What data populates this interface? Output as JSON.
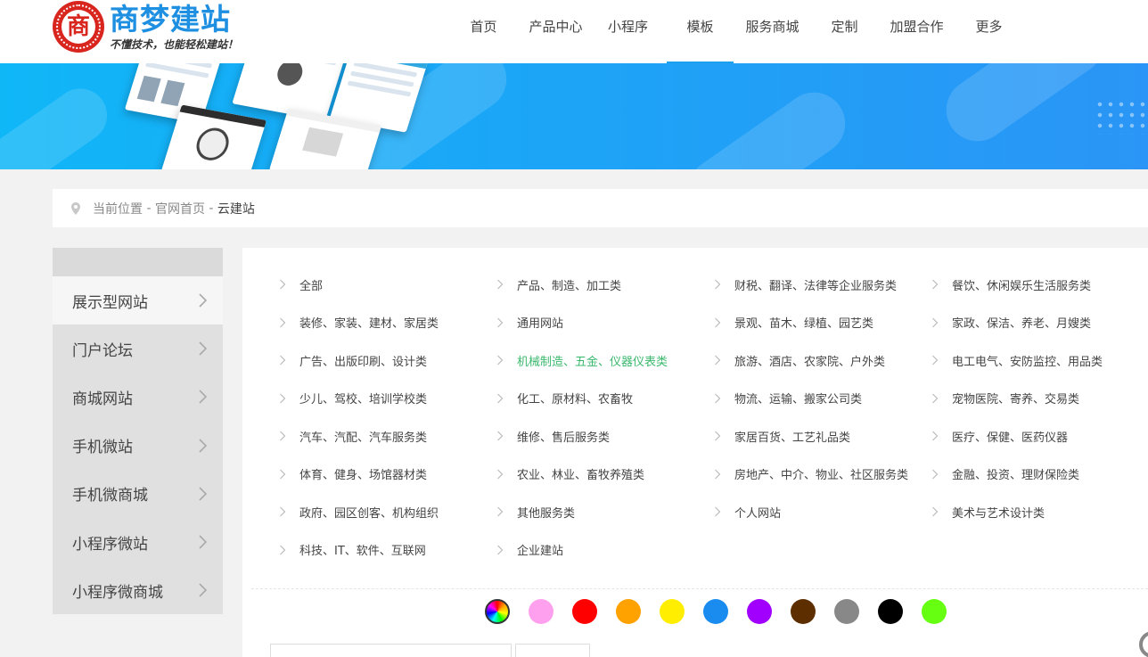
{
  "header": {
    "logo": {
      "seal_char": "商",
      "title": "商梦建站",
      "slogan": "不懂技术，也能轻松建站！"
    },
    "nav": [
      {
        "label": "首页",
        "active": false
      },
      {
        "label": "产品中心",
        "active": false
      },
      {
        "label": "小程序",
        "active": false
      },
      {
        "label": "模板",
        "active": true
      },
      {
        "label": "服务商城",
        "active": false
      },
      {
        "label": "定制",
        "active": false
      },
      {
        "label": "加盟合作",
        "active": false
      },
      {
        "label": "更多",
        "active": false
      }
    ]
  },
  "breadcrumb": {
    "prefix": "当前位置",
    "sep": " - ",
    "home": "官网首页",
    "current": "云建站"
  },
  "sidebar": {
    "items": [
      {
        "label": "展示型网站",
        "active": true
      },
      {
        "label": "门户论坛",
        "active": false
      },
      {
        "label": "商城网站",
        "active": false
      },
      {
        "label": "手机微站",
        "active": false
      },
      {
        "label": "手机微商城",
        "active": false
      },
      {
        "label": "小程序微站",
        "active": false
      },
      {
        "label": "小程序微商城",
        "active": false
      }
    ]
  },
  "categories": [
    {
      "label": "全部"
    },
    {
      "label": "产品、制造、加工类"
    },
    {
      "label": "财税、翻译、法律等企业服务类"
    },
    {
      "label": "餐饮、休闲娱乐生活服务类"
    },
    {
      "label": "装修、家装、建材、家居类"
    },
    {
      "label": "通用网站"
    },
    {
      "label": "景观、苗木、绿植、园艺类"
    },
    {
      "label": "家政、保洁、养老、月嫂类"
    },
    {
      "label": "广告、出版印刷、设计类"
    },
    {
      "label": "机械制造、五金、仪器仪表类",
      "highlight": true
    },
    {
      "label": "旅游、酒店、农家院、户外类"
    },
    {
      "label": "电工电气、安防监控、用品类"
    },
    {
      "label": "少儿、驾校、培训学校类"
    },
    {
      "label": "化工、原材料、农畜牧"
    },
    {
      "label": "物流、运输、搬家公司类"
    },
    {
      "label": "宠物医院、寄养、交易类"
    },
    {
      "label": "汽车、汽配、汽车服务类"
    },
    {
      "label": "维修、售后服务类"
    },
    {
      "label": "家居百货、工艺礼品类"
    },
    {
      "label": "医疗、保健、医药仪器"
    },
    {
      "label": "体育、健身、场馆器材类"
    },
    {
      "label": "农业、林业、畜牧养殖类"
    },
    {
      "label": "房地产、中介、物业、社区服务类"
    },
    {
      "label": "金融、投资、理财保险类"
    },
    {
      "label": "政府、园区创客、机构组织"
    },
    {
      "label": "其他服务类"
    },
    {
      "label": "个人网站"
    },
    {
      "label": "美术与艺术设计类"
    },
    {
      "label": "科技、IT、软件、互联网"
    },
    {
      "label": "企业建站"
    }
  ],
  "colors": [
    "multi",
    "#ffa0ef",
    "#ff0000",
    "#ffa200",
    "#ffee00",
    "#1a8cf0",
    "#a100ff",
    "#5c2e00",
    "#888888",
    "#000000",
    "#66ff11"
  ],
  "search": {
    "placeholder": "",
    "button": ""
  }
}
